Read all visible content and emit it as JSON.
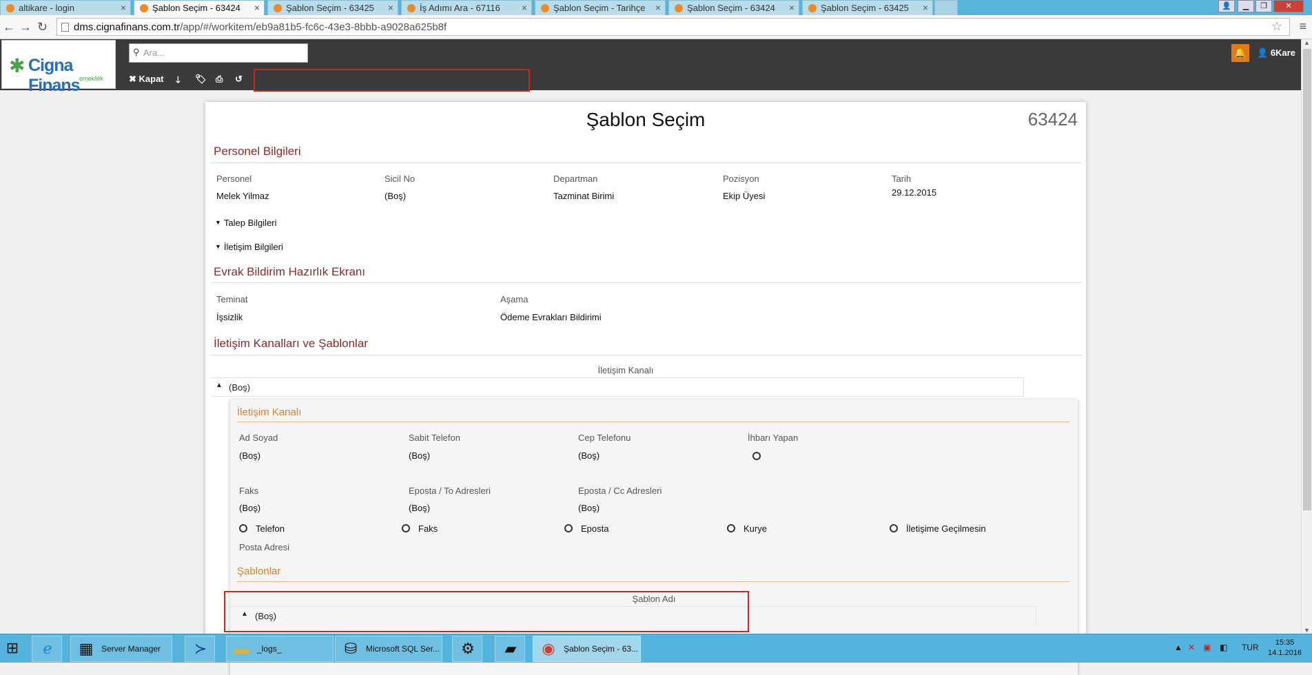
{
  "browser": {
    "tabs": [
      {
        "title": "altikare - login",
        "active": false
      },
      {
        "title": "Şablon Seçim - 63424",
        "active": true
      },
      {
        "title": "Şablon Seçim - 63425",
        "active": false
      },
      {
        "title": "İş Adımı Ara - 67116",
        "active": false
      },
      {
        "title": "Şablon Seçim - Tarihçe",
        "active": false
      },
      {
        "title": "Şablon Seçim - 63424",
        "active": false
      },
      {
        "title": "Şablon Seçim - 63425",
        "active": false
      }
    ],
    "url_host": "dms.cignafinans.com.tr",
    "url_path": "/app/#/workitem/eb9a81b5-fc6c-43e3-8bbb-a9028a625b8f"
  },
  "header": {
    "logo_text": "Cigna Finans",
    "logo_subtext": "emeklilik",
    "search_placeholder": "Ara...",
    "toolbar": {
      "close_label": "Kapat",
      "icons": [
        "arrow-down-icon",
        "tags-icon",
        "print-icon",
        "history-icon"
      ]
    },
    "user_name": "6Kare",
    "accent_color": "#e07b1c"
  },
  "main": {
    "title": "Şablon Seçim",
    "doc_id": "63424",
    "personel": {
      "section_title": "Personel Bilgileri",
      "fields": [
        {
          "label": "Personel",
          "value": "Melek Yilmaz"
        },
        {
          "label": "Sicil No",
          "value": "(Boş)"
        },
        {
          "label": "Departman",
          "value": "Tazminat Birimi"
        },
        {
          "label": "Pozisyon",
          "value": "Ekip Üyesi"
        },
        {
          "label": "Tarih",
          "value": "29.12.2015"
        }
      ],
      "toggles": [
        "Talep Bilgileri",
        "İletişim Bilgileri"
      ]
    },
    "evrak": {
      "section_title": "Evrak Bildirim Hazırlık Ekranı",
      "fields": [
        {
          "label": "Teminat",
          "value": "İşsizlik"
        },
        {
          "label": "Aşama",
          "value": "Ödeme Evrakları Bildirimi"
        }
      ]
    },
    "kanallar": {
      "section_title": "İletişim Kanalları ve Şablonlar",
      "column_header": "İletişim Kanalı",
      "row_value": "(Boş)",
      "detail": {
        "title": "İletişim Kanalı",
        "fields_row1": [
          {
            "label": "Ad Soyad",
            "value": "(Boş)"
          },
          {
            "label": "Sabit Telefon",
            "value": "(Boş)"
          },
          {
            "label": "Cep Telefonu",
            "value": "(Boş)"
          },
          {
            "label": "İhbarı Yapan",
            "value": ""
          }
        ],
        "fields_row2": [
          {
            "label": "Faks",
            "value": "(Boş)"
          },
          {
            "label": "Eposta / To Adresleri",
            "value": "(Boş)"
          },
          {
            "label": "Eposta / Cc Adresleri",
            "value": "(Boş)"
          }
        ],
        "radio_options": [
          "Telefon",
          "Faks",
          "Eposta",
          "Kurye",
          "İletişime Geçilmesin"
        ],
        "posta_label": "Posta Adresi",
        "sablonlar_title": "Şablonlar",
        "sablon_column_header": "Şablon Adı",
        "sablon_row_value": "(Boş)"
      }
    }
  },
  "taskbar": {
    "items": [
      {
        "label": "",
        "icon": "ie-icon"
      },
      {
        "label": "Server Manager",
        "icon": "server-manager-icon"
      },
      {
        "label": "",
        "icon": "powershell-icon"
      },
      {
        "label": "_logs_",
        "icon": "folder-icon"
      },
      {
        "label": "Microsoft SQL Ser...",
        "icon": "sql-server-icon"
      },
      {
        "label": "",
        "icon": "settings-icon"
      },
      {
        "label": "",
        "icon": "tool-icon"
      },
      {
        "label": "Şablon Seçim - 63...",
        "icon": "chrome-icon"
      }
    ],
    "language": "TUR",
    "time": "15:35",
    "date": "14.1.2016"
  }
}
